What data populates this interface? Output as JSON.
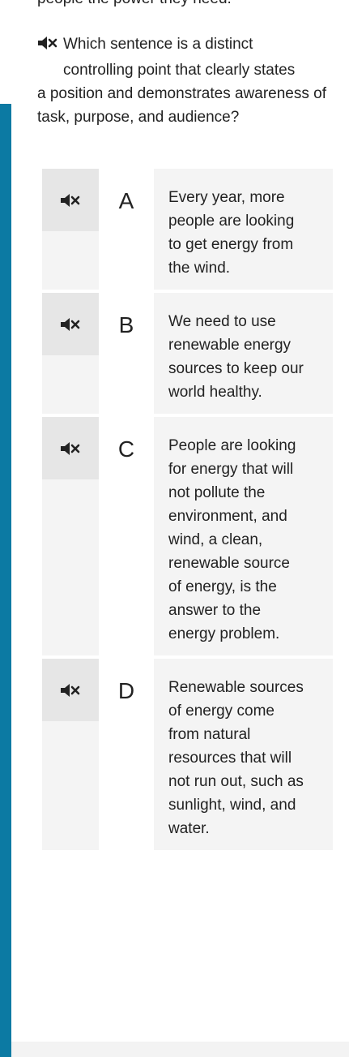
{
  "prev_text": "people the power they need.",
  "question": {
    "line1": "Which sentence is a distinct",
    "line2": "controlling point that clearly states",
    "rest": "a position and demonstrates awareness of task, purpose, and audience?"
  },
  "choices": [
    {
      "letter": "A",
      "text": "Every year, more people are looking to get energy from the wind."
    },
    {
      "letter": "B",
      "text": "We need to use renewable energy sources to keep our world healthy."
    },
    {
      "letter": "C",
      "text": "People are looking for energy that will not pollute the environment, and wind, a clean, renewable source of energy, is the answer to the energy problem."
    },
    {
      "letter": "D",
      "text": "Renewable sources of energy come from natural resources that will not run out, such as sunlight, wind, and water."
    }
  ],
  "icons": {
    "audio": "speaker-muted-icon"
  },
  "colors": {
    "accent_bar": "#0c7aa3",
    "choice_bg": "#f4f4f4",
    "speaker_bg": "#e6e6e6"
  }
}
